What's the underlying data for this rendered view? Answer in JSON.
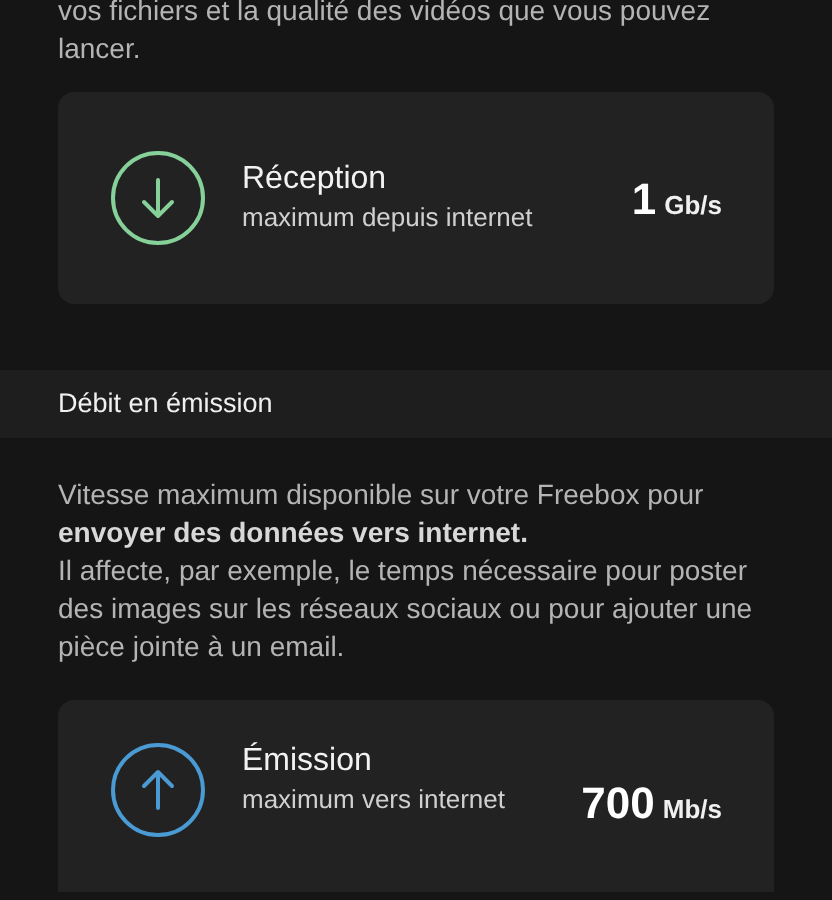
{
  "blocks": [
    {
      "kind": "paragraph",
      "texts": [
        "vos fichiers et la qualité des vidéos que vous pouvez lancer."
      ]
    },
    {
      "kind": "download_card",
      "color": "#86d19a",
      "title": "Réception",
      "subtitle": "maximum depuis internet",
      "value": "1",
      "unit": "Gb/s"
    },
    {
      "kind": "section_header",
      "title": "Débit en émission"
    },
    {
      "kind": "paragraph",
      "texts": [
        "Vitesse maximum disponible sur votre Freebox pour **envoyer des données vers internet.**",
        "Il affecte, par exemple, le temps nécessaire pour poster des images sur les réseaux sociaux ou pour ajouter une pièce jointe à un email."
      ]
    },
    {
      "kind": "upload_card",
      "color": "#4a9ad4",
      "title": "Émission",
      "subtitle": "maximum vers internet",
      "value": "700",
      "unit": "Mb/s"
    }
  ]
}
